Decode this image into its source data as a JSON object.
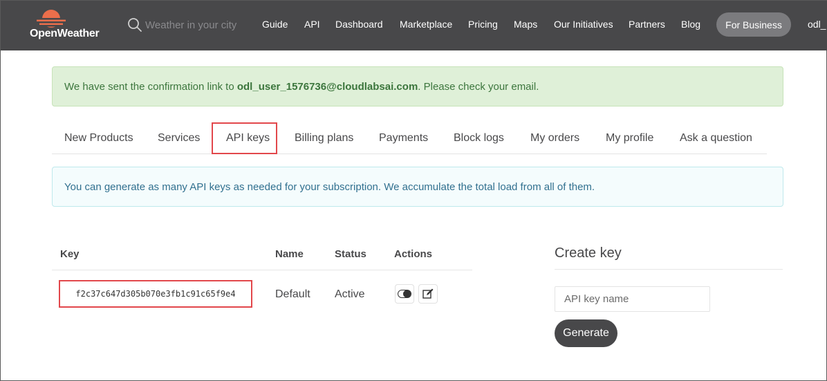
{
  "header": {
    "logo_text": "OpenWeather",
    "search_placeholder": "Weather in your city",
    "nav": [
      "Guide",
      "API",
      "Dashboard",
      "Marketplace",
      "Pricing",
      "Maps",
      "Our Initiatives",
      "Partners",
      "Blog"
    ],
    "business_button": "For Business",
    "user_label": "odl_",
    "colors": {
      "bar": "#48484a",
      "brand": "#eb6e4b"
    }
  },
  "notice": {
    "prefix": "We have sent the confirmation link to ",
    "email": "odl_user_1576736@cloudlabsai.com",
    "suffix": ". Please check your email."
  },
  "tabs": [
    "New Products",
    "Services",
    "API keys",
    "Billing plans",
    "Payments",
    "Block logs",
    "My orders",
    "My profile",
    "Ask a question"
  ],
  "active_tab": "API keys",
  "info_text": "You can generate as many API keys as needed for your subscription. We accumulate the total load from all of them.",
  "table": {
    "headers": {
      "key": "Key",
      "name": "Name",
      "status": "Status",
      "actions": "Actions"
    },
    "rows": [
      {
        "key": "f2c37c647d305b070e3fb1c91c65f9e4",
        "name": "Default",
        "status": "Active"
      }
    ],
    "action_icons": [
      "toggle-icon",
      "edit-icon"
    ]
  },
  "create_key": {
    "title": "Create key",
    "placeholder": "API key name",
    "button": "Generate"
  }
}
